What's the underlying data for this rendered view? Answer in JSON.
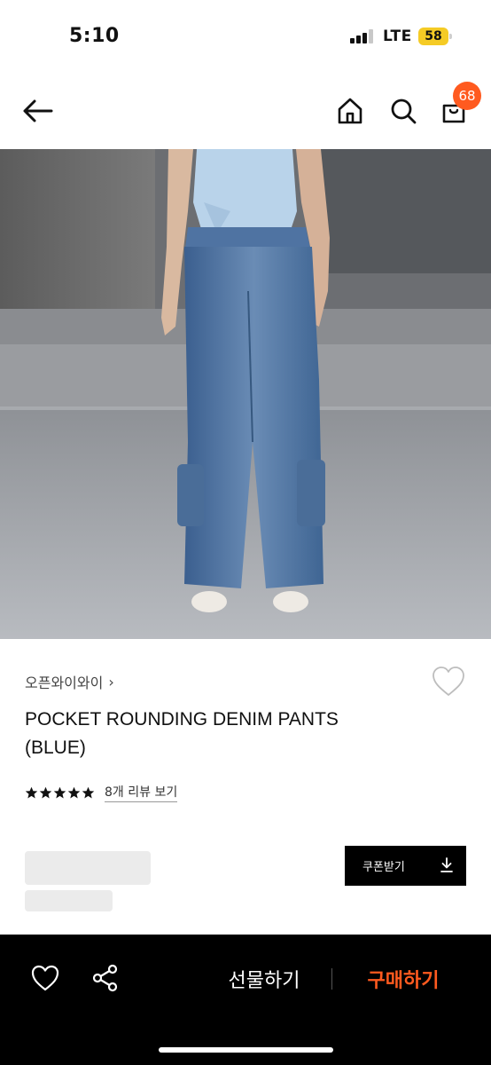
{
  "status_bar": {
    "time": "5:10",
    "network": "LTE",
    "battery": "58"
  },
  "header": {
    "cart_count": "68"
  },
  "product": {
    "brand": "오픈와이와이",
    "title": "POCKET ROUNDING DENIM PANTS (BLUE)",
    "rating_stars": 5,
    "review_link": "8개 리뷰 보기"
  },
  "coupon": {
    "label": "쿠폰받기"
  },
  "bottom_bar": {
    "gift_label": "선물하기",
    "buy_label": "구매하기"
  },
  "colors": {
    "accent": "#ff5a1f",
    "bottom_bar_bg": "#000000",
    "battery": "#f5cb25",
    "skeleton": "#ebebeb"
  },
  "icons": [
    "back-arrow-icon",
    "home-icon",
    "search-icon",
    "shopping-bag-icon",
    "heart-icon",
    "star-icon",
    "download-icon",
    "share-icon"
  ]
}
